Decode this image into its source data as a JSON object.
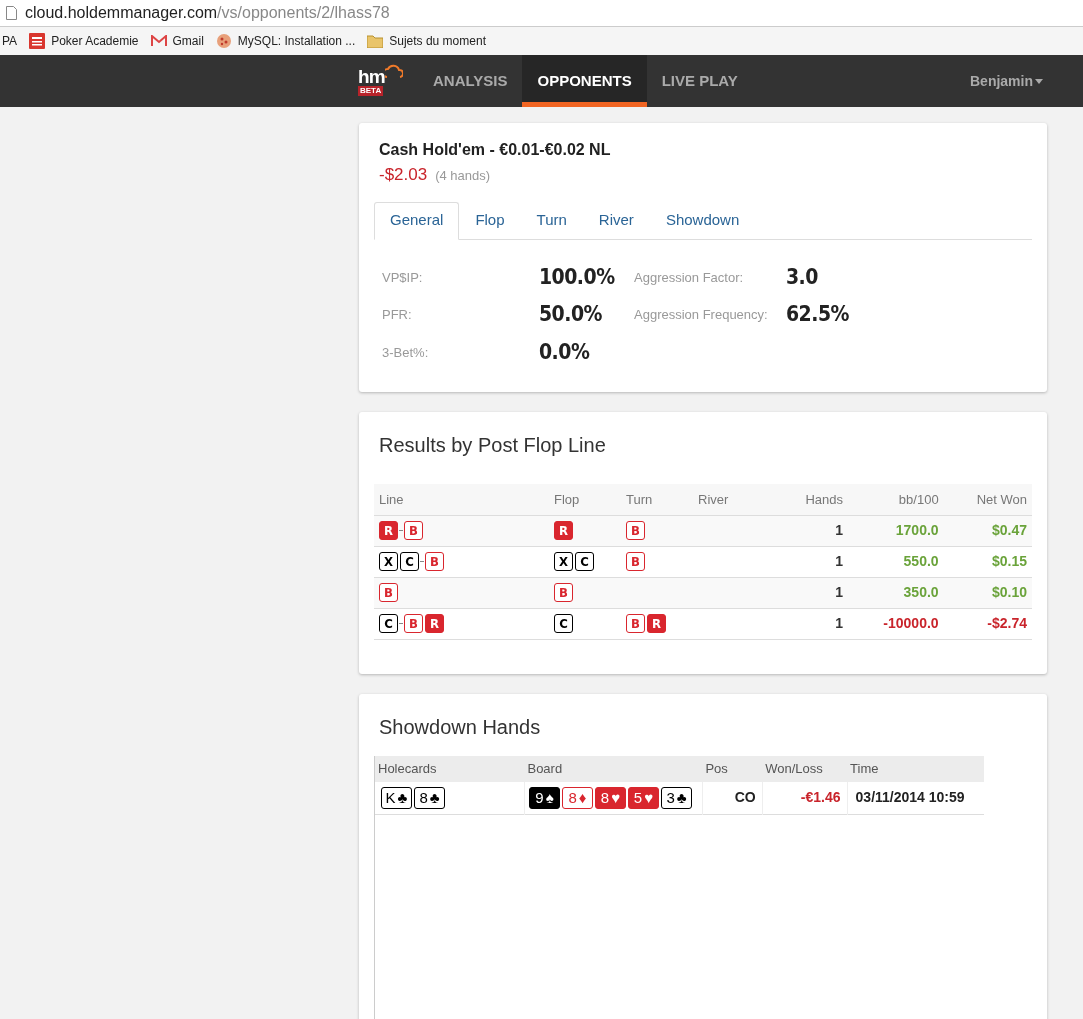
{
  "browser": {
    "url_host": "cloud.holdemmanager.com",
    "url_path": "/vs/opponents/2/lhass78",
    "bookmarks": [
      {
        "label": "PA",
        "kind": "none"
      },
      {
        "label": "Poker Academie",
        "kind": "pa"
      },
      {
        "label": "Gmail",
        "kind": "mail"
      },
      {
        "label": "MySQL: Installation ...",
        "kind": "ball"
      },
      {
        "label": "Sujets du moment",
        "kind": "folder"
      }
    ]
  },
  "navbar": {
    "logo": "hm",
    "logo_badge": "BETA",
    "items": [
      {
        "label": "ANALYSIS",
        "selected": false
      },
      {
        "label": "OPPONENTS",
        "selected": true
      },
      {
        "label": "LIVE PLAY",
        "selected": false
      }
    ],
    "user": "Benjamin"
  },
  "summary": {
    "title": "Cash Hold'em - €0.01-€0.02 NL",
    "result": "-$2.03",
    "hands": "(4 hands)",
    "tabs": [
      {
        "label": "General",
        "selected": true
      },
      {
        "label": "Flop",
        "selected": false
      },
      {
        "label": "Turn",
        "selected": false
      },
      {
        "label": "River",
        "selected": false
      },
      {
        "label": "Showdown",
        "selected": false
      }
    ],
    "stats_left": [
      {
        "label": "VP$IP:",
        "value": "100.0%"
      },
      {
        "label": "PFR:",
        "value": "50.0%"
      },
      {
        "label": "3-Bet%:",
        "value": "0.0%"
      }
    ],
    "stats_right": [
      {
        "label": "Aggression Factor:",
        "value": "3.0"
      },
      {
        "label": "Aggression Frequency:",
        "value": "62.5%"
      }
    ]
  },
  "post_flop": {
    "title": "Results by Post Flop Line",
    "columns": [
      "Line",
      "Flop",
      "Turn",
      "River",
      "Hands",
      "bb/100",
      "Net Won"
    ],
    "rows": [
      {
        "line": [
          [
            {
              "label": "R",
              "kind": "filled"
            }
          ],
          [
            {
              "label": "B",
              "kind": "red"
            }
          ]
        ],
        "flop": [
          {
            "label": "R",
            "kind": "filled"
          }
        ],
        "turn": [
          {
            "label": "B",
            "kind": "red"
          }
        ],
        "river": [],
        "hands": "1",
        "bb100": "1700.0",
        "net": "$0.47",
        "positive": true
      },
      {
        "line": [
          [
            {
              "label": "X",
              "kind": "black"
            },
            {
              "label": "C",
              "kind": "black"
            }
          ],
          [
            {
              "label": "B",
              "kind": "red"
            }
          ]
        ],
        "flop": [
          {
            "label": "X",
            "kind": "black"
          },
          {
            "label": "C",
            "kind": "black"
          }
        ],
        "turn": [
          {
            "label": "B",
            "kind": "red"
          }
        ],
        "river": [],
        "hands": "1",
        "bb100": "550.0",
        "net": "$0.15",
        "positive": true
      },
      {
        "line": [
          [
            {
              "label": "B",
              "kind": "red"
            }
          ]
        ],
        "flop": [
          {
            "label": "B",
            "kind": "red"
          }
        ],
        "turn": [],
        "river": [],
        "hands": "1",
        "bb100": "350.0",
        "net": "$0.10",
        "positive": true
      },
      {
        "line": [
          [
            {
              "label": "C",
              "kind": "black"
            }
          ],
          [
            {
              "label": "B",
              "kind": "red"
            },
            {
              "label": "R",
              "kind": "filled"
            }
          ]
        ],
        "flop": [
          {
            "label": "C",
            "kind": "black"
          }
        ],
        "turn": [
          {
            "label": "B",
            "kind": "red"
          },
          {
            "label": "R",
            "kind": "filled"
          }
        ],
        "river": [],
        "hands": "1",
        "bb100": "-10000.0",
        "net": "-$2.74",
        "positive": false
      }
    ]
  },
  "showdown": {
    "title": "Showdown Hands",
    "columns": [
      "Holecards",
      "Board",
      "Pos",
      "Won/Loss",
      "Time"
    ],
    "rows": [
      {
        "holecards": [
          {
            "rank": "K",
            "suit": "♣",
            "kind": "black"
          },
          {
            "rank": "8",
            "suit": "♣",
            "kind": "black"
          }
        ],
        "board": [
          {
            "rank": "9",
            "suit": "♠",
            "kind": "black-filled"
          },
          {
            "rank": "8",
            "suit": "♦",
            "kind": "red"
          },
          {
            "rank": "8",
            "suit": "♥",
            "kind": "red-filled"
          },
          {
            "rank": "5",
            "suit": "♥",
            "kind": "red-filled"
          },
          {
            "rank": "3",
            "suit": "♣",
            "kind": "black"
          }
        ],
        "pos": "CO",
        "result": "-€1.46",
        "positive": false,
        "time": "03/11/2014 10:59"
      }
    ]
  }
}
